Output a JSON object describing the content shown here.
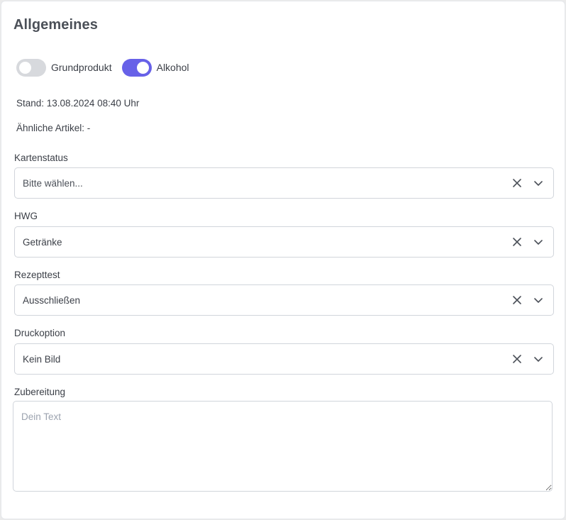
{
  "section": {
    "title": "Allgemeines"
  },
  "toggles": [
    {
      "label": "Grundprodukt",
      "checked": false
    },
    {
      "label": "Alkohol",
      "checked": true
    }
  ],
  "accent_color": "#6761e8",
  "info": {
    "stand": "Stand: 13.08.2024 08:40 Uhr",
    "similar": "Ähnliche Artikel: -"
  },
  "fields": {
    "kartenstatus": {
      "label": "Kartenstatus",
      "value": "Bitte wählen..."
    },
    "hwg": {
      "label": "HWG",
      "value": "Getränke"
    },
    "rezepttest": {
      "label": "Rezepttest",
      "value": "Ausschließen"
    },
    "druckoption": {
      "label": "Druckoption",
      "value": "Kein Bild"
    },
    "zubereitung": {
      "label": "Zubereitung",
      "placeholder": "Dein Text",
      "value": ""
    }
  },
  "icons": {
    "clear": "close-icon",
    "expand": "chevron-down-icon"
  }
}
